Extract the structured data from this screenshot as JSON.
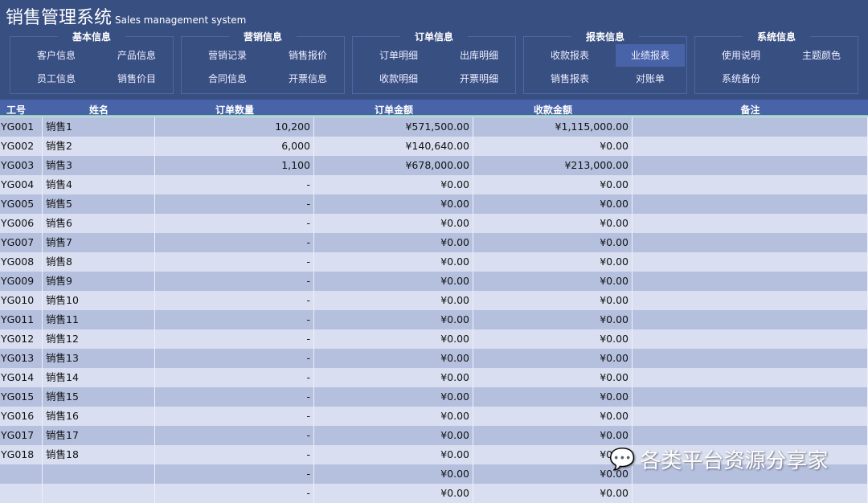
{
  "title": "销售管理系统",
  "subtitle": "Sales management system",
  "groups": [
    {
      "title": "基本信息",
      "items": [
        "客户信息",
        "产品信息",
        "员工信息",
        "销售价目"
      ]
    },
    {
      "title": "营销信息",
      "items": [
        "营销记录",
        "销售报价",
        "合同信息",
        "开票信息"
      ]
    },
    {
      "title": "订单信息",
      "items": [
        "订单明细",
        "出库明细",
        "收款明细",
        "开票明细"
      ]
    },
    {
      "title": "报表信息",
      "items": [
        "收款报表",
        "业绩报表",
        "销售报表",
        "对账单"
      ],
      "active": 1
    },
    {
      "title": "系统信息",
      "items": [
        "使用说明",
        "主题颜色",
        "系统备份",
        ""
      ]
    }
  ],
  "columns": [
    "工号",
    "姓名",
    "订单数量",
    "订单金额",
    "收款金额",
    "备注"
  ],
  "rows": [
    [
      "YG001",
      "销售1",
      "10,200",
      "¥571,500.00",
      "¥1,115,000.00",
      ""
    ],
    [
      "YG002",
      "销售2",
      "6,000",
      "¥140,640.00",
      "¥0.00",
      ""
    ],
    [
      "YG003",
      "销售3",
      "1,100",
      "¥678,000.00",
      "¥213,000.00",
      ""
    ],
    [
      "YG004",
      "销售4",
      "-",
      "¥0.00",
      "¥0.00",
      ""
    ],
    [
      "YG005",
      "销售5",
      "-",
      "¥0.00",
      "¥0.00",
      ""
    ],
    [
      "YG006",
      "销售6",
      "-",
      "¥0.00",
      "¥0.00",
      ""
    ],
    [
      "YG007",
      "销售7",
      "-",
      "¥0.00",
      "¥0.00",
      ""
    ],
    [
      "YG008",
      "销售8",
      "-",
      "¥0.00",
      "¥0.00",
      ""
    ],
    [
      "YG009",
      "销售9",
      "-",
      "¥0.00",
      "¥0.00",
      ""
    ],
    [
      "YG010",
      "销售10",
      "-",
      "¥0.00",
      "¥0.00",
      ""
    ],
    [
      "YG011",
      "销售11",
      "-",
      "¥0.00",
      "¥0.00",
      ""
    ],
    [
      "YG012",
      "销售12",
      "-",
      "¥0.00",
      "¥0.00",
      ""
    ],
    [
      "YG013",
      "销售13",
      "-",
      "¥0.00",
      "¥0.00",
      ""
    ],
    [
      "YG014",
      "销售14",
      "-",
      "¥0.00",
      "¥0.00",
      ""
    ],
    [
      "YG015",
      "销售15",
      "-",
      "¥0.00",
      "¥0.00",
      ""
    ],
    [
      "YG016",
      "销售16",
      "-",
      "¥0.00",
      "¥0.00",
      ""
    ],
    [
      "YG017",
      "销售17",
      "-",
      "¥0.00",
      "¥0.00",
      ""
    ],
    [
      "YG018",
      "销售18",
      "-",
      "¥0.00",
      "¥0.00",
      ""
    ],
    [
      "",
      "",
      "-",
      "¥0.00",
      "¥0.00",
      ""
    ],
    [
      "",
      "",
      "-",
      "¥0.00",
      "¥0.00",
      ""
    ]
  ],
  "watermark": "各类平台资源分享家"
}
